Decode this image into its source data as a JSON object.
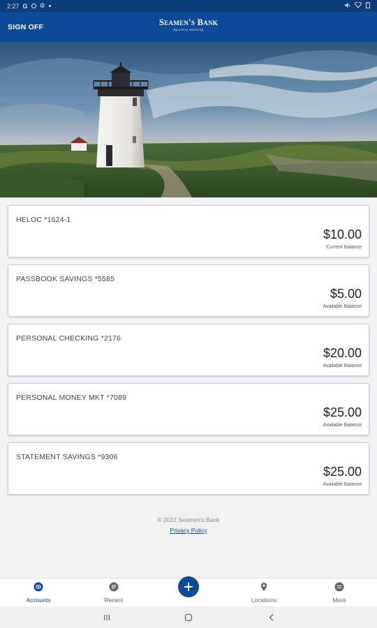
{
  "status_bar": {
    "time": "2:27",
    "carrier_letter": "G"
  },
  "header": {
    "sign_off_label": "SIGN OFF",
    "logo_text": "Seamen's Bank",
    "logo_subtext": "Business Banking"
  },
  "accounts": [
    {
      "name": "HELOC *1624-1",
      "balance": "$10.00",
      "balance_label": "Current Balance"
    },
    {
      "name": "PASSBOOK SAVINGS *5585",
      "balance": "$5.00",
      "balance_label": "Available Balance"
    },
    {
      "name": "PERSONAL CHECKING *2176",
      "balance": "$20.00",
      "balance_label": "Available Balance"
    },
    {
      "name": "PERSONAL MONEY MKT *7089",
      "balance": "$25.00",
      "balance_label": "Available Balance"
    },
    {
      "name": "STATEMENT SAVINGS *9306",
      "balance": "$25.00",
      "balance_label": "Available Balance"
    }
  ],
  "footer": {
    "copyright": "© 2022 Seamen's Bank",
    "privacy_link": "Privacy Policy"
  },
  "bottom_nav": {
    "items": [
      {
        "label": "Accounts",
        "icon": "accounts-icon",
        "active": true
      },
      {
        "label": "Recent",
        "icon": "recent-icon",
        "active": false
      },
      {
        "label": "Locations",
        "icon": "location-pin-icon",
        "active": false
      },
      {
        "label": "More",
        "icon": "more-icon",
        "active": false
      }
    ],
    "fab_icon": "plus-icon"
  },
  "colors": {
    "brand_blue": "#0b4a96",
    "status_blue": "#0a3d7a",
    "background": "#f2f2f2"
  }
}
